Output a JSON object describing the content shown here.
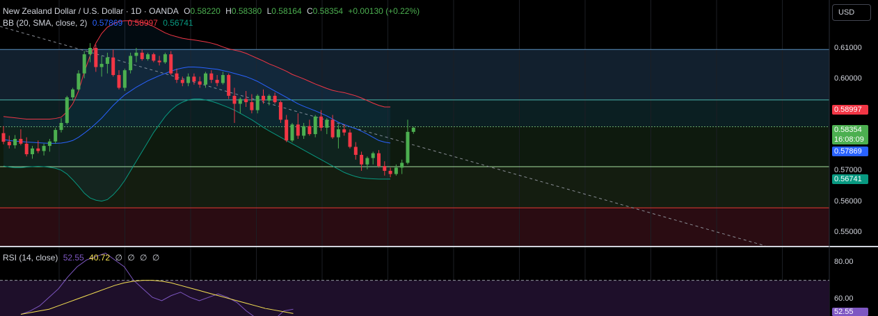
{
  "header": {
    "symbol": "New Zealand Dollar / U.S. Dollar · 1D · OANDA",
    "o_label": "O",
    "o": "0.58220",
    "h_label": "H",
    "h": "0.58380",
    "l_label": "L",
    "l": "0.58164",
    "c_label": "C",
    "c": "0.58354",
    "change": "+0.00130 (+0.22%)"
  },
  "bb": {
    "label": "BB (20, SMA, close, 2)",
    "basis": "0.57869",
    "upper": "0.58997",
    "lower": "0.56741"
  },
  "rsi": {
    "label": "RSI (14, close)",
    "value": "52.55",
    "ma": "40.72",
    "extras": [
      "∅",
      "∅",
      "∅",
      "∅"
    ],
    "tag": "52.55"
  },
  "axis": {
    "currency_button": "USD",
    "price_ticks": [
      "0.61000",
      "0.60000",
      "0.57000",
      "0.56000",
      "0.55000"
    ],
    "rsi_ticks": [
      "80.00",
      "60.00"
    ],
    "tags": {
      "upper": "0.58997",
      "close": "0.58354",
      "countdown": "16:08:09",
      "basis": "0.57869",
      "lower": "0.56741"
    }
  },
  "colors": {
    "up": "#4caf50",
    "down": "#f23645",
    "bb_basis": "#2962ff",
    "bb_upper": "#f23645",
    "bb_lower": "#089981",
    "rsi": "#7e57c2",
    "rsi_ma": "#f7e253"
  },
  "chart_data": {
    "type": "candlestick",
    "price_range": [
      0.5465,
      0.6235
    ],
    "candles": [
      [
        0.5818,
        0.584,
        0.5783,
        0.5791
      ],
      [
        0.5791,
        0.581,
        0.577,
        0.578
      ],
      [
        0.578,
        0.5812,
        0.577,
        0.58
      ],
      [
        0.58,
        0.583,
        0.578,
        0.5785
      ],
      [
        0.5785,
        0.5805,
        0.5745,
        0.5752
      ],
      [
        0.5752,
        0.5778,
        0.5738,
        0.577
      ],
      [
        0.577,
        0.5795,
        0.5755,
        0.5762
      ],
      [
        0.5762,
        0.5785,
        0.5748,
        0.5778
      ],
      [
        0.5778,
        0.58,
        0.576,
        0.5792
      ],
      [
        0.5792,
        0.5835,
        0.5785,
        0.5828
      ],
      [
        0.5828,
        0.5865,
        0.582,
        0.585
      ],
      [
        0.585,
        0.5935,
        0.5845,
        0.593
      ],
      [
        0.593,
        0.596,
        0.592,
        0.5955
      ],
      [
        0.5955,
        0.6015,
        0.595,
        0.6005
      ],
      [
        0.6005,
        0.6075,
        0.599,
        0.6065
      ],
      [
        0.6065,
        0.61,
        0.604,
        0.6085
      ],
      [
        0.6085,
        0.6095,
        0.601,
        0.6025
      ],
      [
        0.6025,
        0.606,
        0.5995,
        0.6035
      ],
      [
        0.6035,
        0.607,
        0.6005,
        0.6055
      ],
      [
        0.6055,
        0.608,
        0.5995,
        0.6
      ],
      [
        0.6,
        0.6015,
        0.5955,
        0.596
      ],
      [
        0.596,
        0.602,
        0.595,
        0.6015
      ],
      [
        0.6015,
        0.607,
        0.6005,
        0.606
      ],
      [
        0.606,
        0.6085,
        0.604,
        0.607
      ],
      [
        0.607,
        0.608,
        0.6045,
        0.605
      ],
      [
        0.605,
        0.607,
        0.6045,
        0.6065
      ],
      [
        0.6065,
        0.607,
        0.604,
        0.6045
      ],
      [
        0.6045,
        0.606,
        0.603,
        0.604
      ],
      [
        0.604,
        0.607,
        0.6035,
        0.6065
      ],
      [
        0.6065,
        0.6075,
        0.6,
        0.6005
      ],
      [
        0.6005,
        0.602,
        0.5975,
        0.5985
      ],
      [
        0.5985,
        0.5995,
        0.5965,
        0.5975
      ],
      [
        0.5975,
        0.6005,
        0.5965,
        0.5995
      ],
      [
        0.5995,
        0.6005,
        0.597,
        0.598
      ],
      [
        0.598,
        0.5995,
        0.596,
        0.597
      ],
      [
        0.597,
        0.601,
        0.596,
        0.6005
      ],
      [
        0.6005,
        0.6015,
        0.5975,
        0.5985
      ],
      [
        0.5985,
        0.6,
        0.5965,
        0.5975
      ],
      [
        0.5975,
        0.601,
        0.597,
        0.6
      ],
      [
        0.6,
        0.6005,
        0.5925,
        0.5935
      ],
      [
        0.5935,
        0.596,
        0.585,
        0.591
      ],
      [
        0.591,
        0.593,
        0.588,
        0.5925
      ],
      [
        0.5925,
        0.595,
        0.59,
        0.5915
      ],
      [
        0.5915,
        0.594,
        0.588,
        0.589
      ],
      [
        0.589,
        0.594,
        0.588,
        0.5935
      ],
      [
        0.5935,
        0.5955,
        0.591,
        0.592
      ],
      [
        0.592,
        0.594,
        0.5905,
        0.5935
      ],
      [
        0.5935,
        0.5945,
        0.591,
        0.5915
      ],
      [
        0.5915,
        0.592,
        0.585,
        0.586
      ],
      [
        0.586,
        0.5875,
        0.579,
        0.5795
      ],
      [
        0.5795,
        0.585,
        0.579,
        0.5845
      ],
      [
        0.5845,
        0.588,
        0.58,
        0.581
      ],
      [
        0.581,
        0.585,
        0.58,
        0.584
      ],
      [
        0.584,
        0.586,
        0.581,
        0.5815
      ],
      [
        0.5815,
        0.5875,
        0.5805,
        0.587
      ],
      [
        0.587,
        0.589,
        0.5825,
        0.5835
      ],
      [
        0.5835,
        0.5865,
        0.5815,
        0.586
      ],
      [
        0.586,
        0.5875,
        0.58,
        0.5805
      ],
      [
        0.5805,
        0.5845,
        0.577,
        0.583
      ],
      [
        0.583,
        0.5845,
        0.581,
        0.582
      ],
      [
        0.582,
        0.583,
        0.577,
        0.5775
      ],
      [
        0.5775,
        0.579,
        0.5735,
        0.575
      ],
      [
        0.575,
        0.576,
        0.57,
        0.572
      ],
      [
        0.572,
        0.5745,
        0.5705,
        0.574
      ],
      [
        0.574,
        0.576,
        0.572,
        0.5755
      ],
      [
        0.5755,
        0.5765,
        0.571,
        0.5715
      ],
      [
        0.5715,
        0.573,
        0.5685,
        0.57
      ],
      [
        0.57,
        0.571,
        0.568,
        0.569
      ],
      [
        0.569,
        0.572,
        0.5685,
        0.571
      ],
      [
        0.571,
        0.5735,
        0.569,
        0.5725
      ],
      [
        0.5725,
        0.586,
        0.572,
        0.5822
      ],
      [
        0.5822,
        0.5838,
        0.5816,
        0.5835
      ]
    ],
    "bb_upper": [
      0.587,
      0.5868,
      0.5866,
      0.5864,
      0.5862,
      0.5862,
      0.5862,
      0.5862,
      0.5862,
      0.5864,
      0.5868,
      0.5885,
      0.591,
      0.595,
      0.601,
      0.606,
      0.61,
      0.613,
      0.615,
      0.616,
      0.6168,
      0.617,
      0.617,
      0.6168,
      0.6165,
      0.616,
      0.6152,
      0.6142,
      0.6132,
      0.6125,
      0.612,
      0.6115,
      0.6112,
      0.611,
      0.6107,
      0.6104,
      0.61,
      0.6095,
      0.6088,
      0.6082,
      0.6078,
      0.6074,
      0.6068,
      0.606,
      0.6052,
      0.6044,
      0.6035,
      0.6028,
      0.602,
      0.6012,
      0.6002,
      0.5995,
      0.5988,
      0.598,
      0.5972,
      0.5965,
      0.5958,
      0.5952,
      0.5948,
      0.5945,
      0.594,
      0.5935,
      0.5928,
      0.592,
      0.5912,
      0.5905,
      0.59,
      0.59
    ],
    "bb_basis": [
      0.5798,
      0.5795,
      0.5793,
      0.5792,
      0.579,
      0.5789,
      0.5788,
      0.5787,
      0.5786,
      0.5786,
      0.5787,
      0.579,
      0.5795,
      0.5805,
      0.5818,
      0.5832,
      0.5848,
      0.5865,
      0.5885,
      0.5905,
      0.5922,
      0.5938,
      0.595,
      0.5962,
      0.5972,
      0.5982,
      0.599,
      0.5998,
      0.6005,
      0.6012,
      0.6018,
      0.6022,
      0.6025,
      0.6025,
      0.6024,
      0.6022,
      0.602,
      0.6018,
      0.6014,
      0.601,
      0.6005,
      0.6,
      0.5995,
      0.5988,
      0.598,
      0.597,
      0.596,
      0.595,
      0.594,
      0.593,
      0.592,
      0.591,
      0.5902,
      0.5895,
      0.5888,
      0.588,
      0.5872,
      0.5862,
      0.5852,
      0.5845,
      0.5838,
      0.5832,
      0.5824,
      0.5815,
      0.5805,
      0.5795,
      0.579,
      0.5787
    ],
    "bb_lower": [
      0.5715,
      0.5712,
      0.571,
      0.571,
      0.5712,
      0.5713,
      0.5714,
      0.5713,
      0.5711,
      0.5708,
      0.5702,
      0.569,
      0.5672,
      0.5652,
      0.563,
      0.5615,
      0.5608,
      0.5605,
      0.561,
      0.5625,
      0.5645,
      0.567,
      0.57,
      0.573,
      0.576,
      0.579,
      0.582,
      0.5845,
      0.587,
      0.589,
      0.5905,
      0.5915,
      0.5922,
      0.5925,
      0.5925,
      0.5922,
      0.5918,
      0.5912,
      0.5905,
      0.5898,
      0.589,
      0.588,
      0.587,
      0.586,
      0.5848,
      0.5836,
      0.5825,
      0.5815,
      0.5805,
      0.5795,
      0.5785,
      0.5775,
      0.5765,
      0.5755,
      0.5745,
      0.5735,
      0.5725,
      0.5715,
      0.5705,
      0.5695,
      0.5688,
      0.5682,
      0.5678,
      0.5676,
      0.5675,
      0.5674,
      0.5674,
      0.5674
    ],
    "horizontal_levels": [
      0.608,
      0.5922,
      0.5838,
      0.5713,
      0.5584
    ],
    "rsi_range": [
      49,
      87
    ],
    "rsi_ma_values": [
      50,
      51,
      52,
      53,
      55,
      57,
      59,
      61,
      63,
      65,
      67,
      68.5,
      69.5,
      70,
      70,
      69.5,
      68.5,
      67,
      65.5,
      64,
      62.5,
      61,
      59.5,
      58,
      56.5,
      55,
      53.5,
      52.5,
      51.5,
      50.5
    ],
    "rsi_values": [
      50,
      52,
      55,
      60,
      65,
      72,
      78,
      82,
      84,
      86,
      82,
      78,
      70,
      65,
      60,
      58,
      61,
      63,
      60,
      58,
      60,
      62,
      60,
      57,
      52,
      48,
      46,
      47,
      52,
      53
    ]
  }
}
